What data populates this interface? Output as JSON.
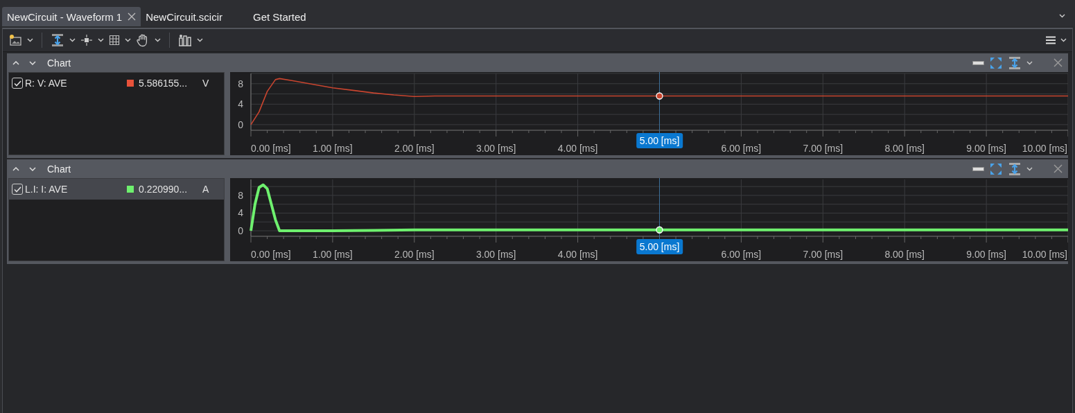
{
  "tabs": [
    {
      "label": "NewCircuit - Waveform 1",
      "selected": true,
      "closable": true
    },
    {
      "label": "NewCircuit.scicir",
      "selected": false,
      "closable": false
    },
    {
      "label": "Get Started",
      "selected": false,
      "closable": false
    }
  ],
  "panels": [
    {
      "title": "Chart",
      "legend": [
        {
          "name": "R: V: AVE",
          "checked": true,
          "selected": false,
          "color": "#e8523a",
          "value": "5.586155...",
          "unit": "V"
        }
      ],
      "chart_data": {
        "type": "line",
        "grid": true,
        "x": [
          0,
          0.1,
          0.2,
          0.3,
          0.35,
          0.5,
          0.75,
          1,
          1.25,
          1.5,
          1.75,
          2,
          2.25,
          2.5,
          3,
          4,
          5,
          6,
          7,
          8,
          9,
          10
        ],
        "series": [
          {
            "color": "#c9452f",
            "values": [
              0,
              2.5,
              6.5,
              8.8,
              9,
              8.6,
              7.9,
              7.2,
              6.7,
              6.2,
              5.8,
              5.5,
              5.6,
              5.6,
              5.6,
              5.6,
              5.6,
              5.6,
              5.6,
              5.6,
              5.6,
              5.6
            ]
          }
        ],
        "xlim": [
          0,
          10
        ],
        "ylim": [
          -1.1,
          10
        ],
        "xticks": [
          {
            "value": 0,
            "label": "0.00 [ms]"
          },
          {
            "value": 1,
            "label": "1.00 [ms]"
          },
          {
            "value": 2,
            "label": "2.00 [ms]"
          },
          {
            "value": 3,
            "label": "3.00 [ms]"
          },
          {
            "value": 4,
            "label": "4.00 [ms]"
          },
          {
            "value": 6,
            "label": "6.00 [ms]"
          },
          {
            "value": 7,
            "label": "7.00 [ms]"
          },
          {
            "value": 8,
            "label": "8.00 [ms]"
          },
          {
            "value": 9,
            "label": "9.00 [ms]"
          },
          {
            "value": 10,
            "label": "10.00 [ms]"
          }
        ],
        "yticks": [
          0,
          4,
          8
        ],
        "ref_lines": [
          {
            "axis": "x",
            "value": 5,
            "color": "#3c6f98"
          }
        ],
        "annotations": [
          "5.00 [ms]"
        ]
      }
    },
    {
      "title": "Chart",
      "legend": [
        {
          "name": "L.I: I: AVE",
          "checked": true,
          "selected": true,
          "color": "#6ef06e",
          "value": "0.220990...",
          "unit": "A"
        }
      ],
      "chart_data": {
        "type": "line",
        "grid": true,
        "x": [
          0,
          0.05,
          0.1,
          0.15,
          0.2,
          0.25,
          0.3,
          0.35,
          0.5,
          1,
          1.5,
          2,
          2.5,
          3,
          4,
          5,
          6,
          7,
          8,
          9,
          10
        ],
        "series": [
          {
            "color": "#6ef06e",
            "values": [
              0,
              6,
              9.8,
              10.4,
              9.5,
              6,
              2.5,
              0,
              0,
              0,
              0.1,
              0.2,
              0.2,
              0.2,
              0.2,
              0.2,
              0.2,
              0.2,
              0.2,
              0.2,
              0.2
            ]
          }
        ],
        "xlim": [
          0,
          10
        ],
        "ylim": [
          -1.25,
          11.6
        ],
        "xticks": [
          {
            "value": 0,
            "label": "0.00 [ms]"
          },
          {
            "value": 1,
            "label": "1.00 [ms]"
          },
          {
            "value": 2,
            "label": "2.00 [ms]"
          },
          {
            "value": 3,
            "label": "3.00 [ms]"
          },
          {
            "value": 4,
            "label": "4.00 [ms]"
          },
          {
            "value": 6,
            "label": "6.00 [ms]"
          },
          {
            "value": 7,
            "label": "7.00 [ms]"
          },
          {
            "value": 8,
            "label": "8.00 [ms]"
          },
          {
            "value": 9,
            "label": "9.00 [ms]"
          },
          {
            "value": 10,
            "label": "10.00 [ms]"
          }
        ],
        "yticks": [
          0,
          4,
          8
        ],
        "ref_lines": [
          {
            "axis": "x",
            "value": 5,
            "color": "#3c6f98"
          }
        ],
        "annotations": [
          "5.00 [ms]"
        ]
      }
    }
  ]
}
